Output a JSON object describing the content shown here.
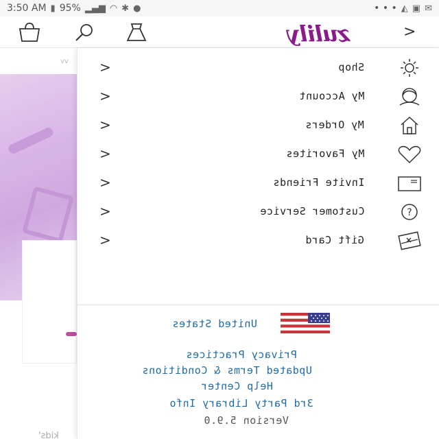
{
  "status_bar": {
    "time": "3:50 AM",
    "battery": "95%",
    "dots": "• • •"
  },
  "header": {
    "logo_text": "zulily",
    "icons": [
      "shopping-bag-icon",
      "search-icon",
      "dress-icon",
      "back-chevron-icon"
    ]
  },
  "menu": {
    "items": [
      {
        "label": "Shop",
        "icon": "sun-icon"
      },
      {
        "label": "My Account",
        "icon": "person-icon"
      },
      {
        "label": "My Orders",
        "icon": "house-icon"
      },
      {
        "label": "My Favorites",
        "icon": "heart-icon"
      },
      {
        "label": "Invite Friends",
        "icon": "envelope-icon"
      },
      {
        "label": "Customer Service",
        "icon": "question-icon"
      },
      {
        "label": "Gift Card",
        "icon": "gift-card-icon"
      }
    ],
    "chevron": ">"
  },
  "footer": {
    "country": "United States",
    "links": [
      "Privacy Practices",
      "Updated Terms & Conditions",
      "Help Center",
      "3rd Party Library Info"
    ],
    "version": "Version 5.9.0"
  },
  "background": {
    "fragment_text": "kids'"
  },
  "colors": {
    "brand": "#8b1a8b",
    "link": "#1f6aa8",
    "hero": "#d9b5e6"
  }
}
